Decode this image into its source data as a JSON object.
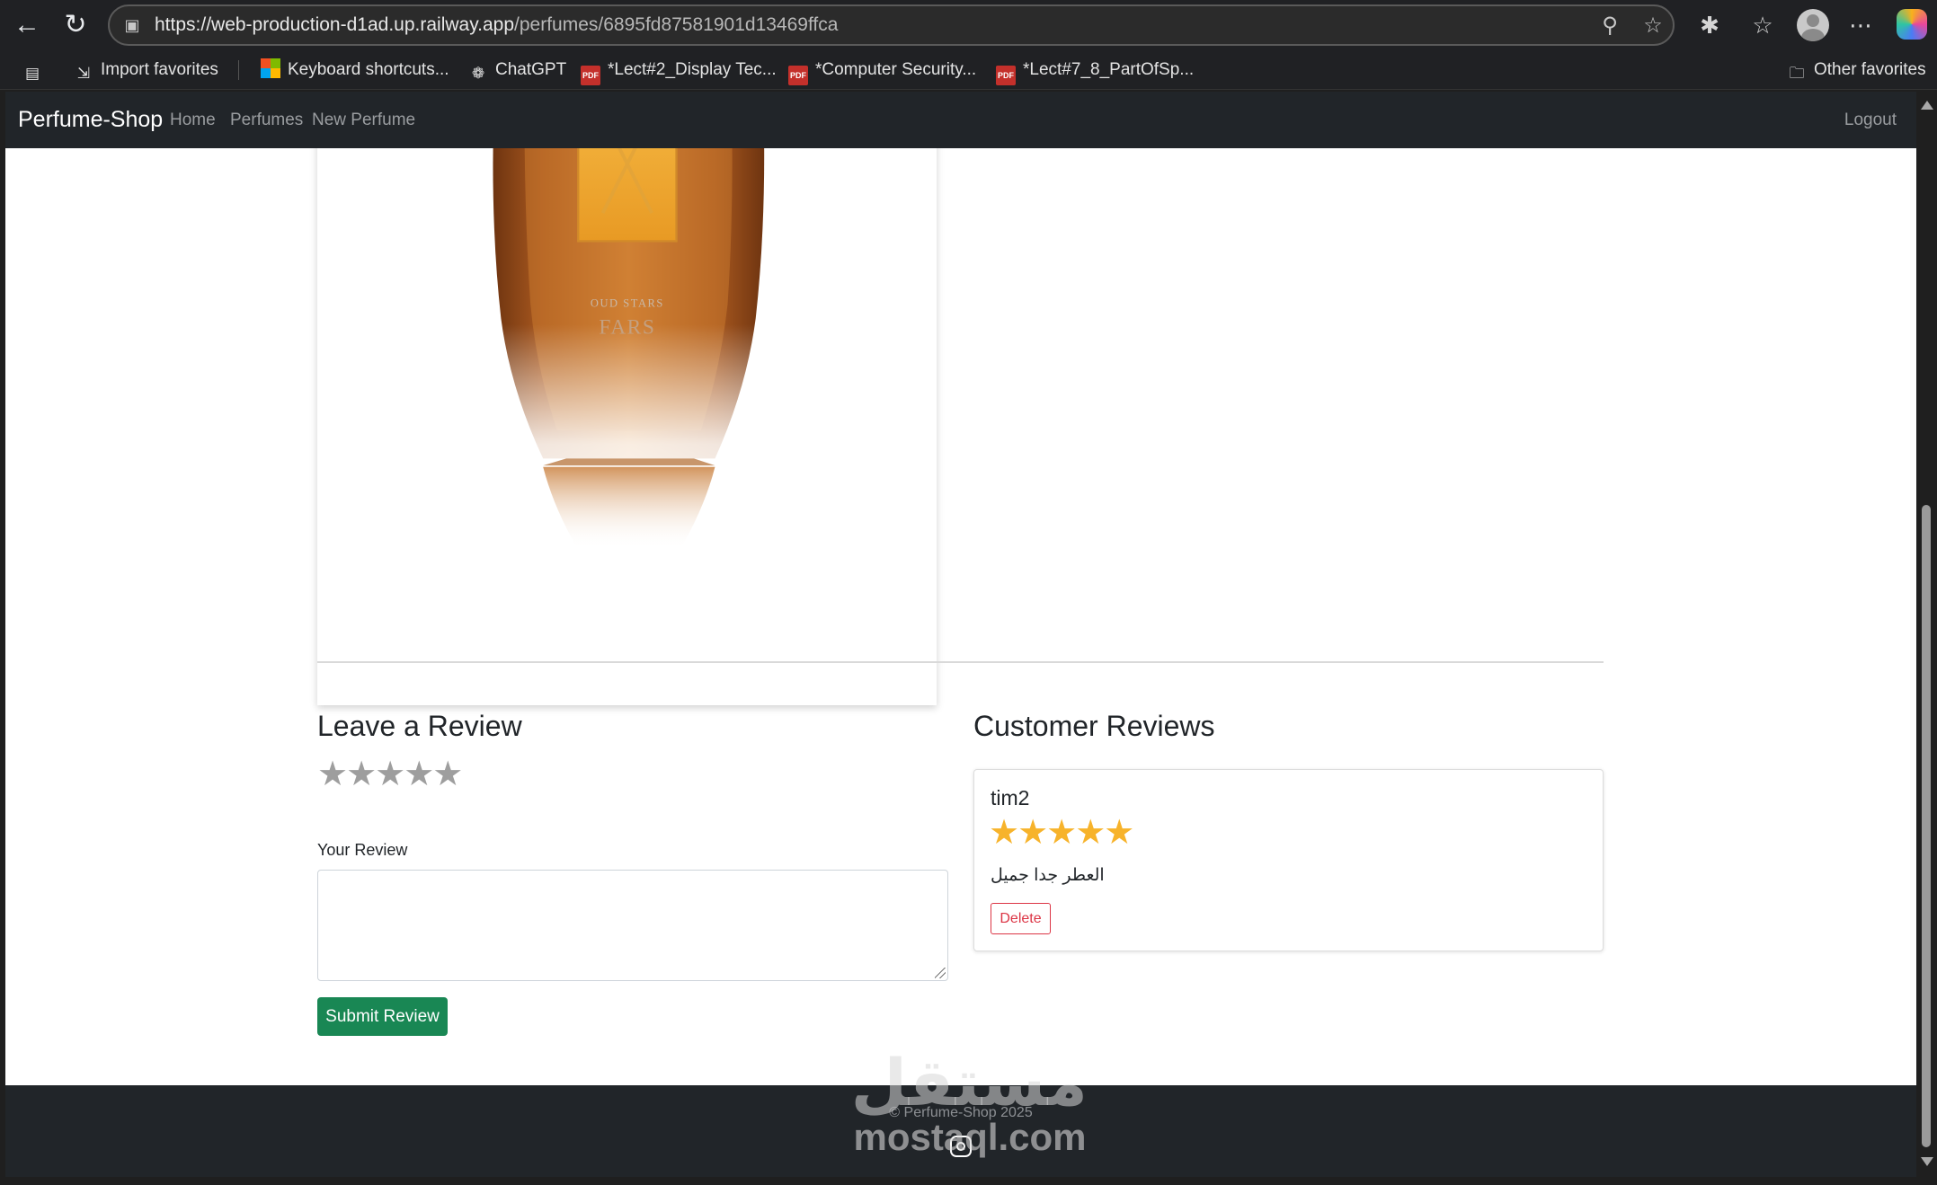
{
  "browser": {
    "url_host": "https://web-production-d1ad.up.railway.app",
    "url_path": "/perfumes/6895fd87581901d13469ffca",
    "bookmarks": [
      {
        "label": "Import favorites",
        "icon": "import-icon"
      },
      {
        "label": "Keyboard shortcuts...",
        "icon": "microsoft-icon"
      },
      {
        "label": "ChatGPT",
        "icon": "chatgpt-icon"
      },
      {
        "label": "*Lect#2_Display Tec...",
        "icon": "pdf-icon"
      },
      {
        "label": "*Computer Security...",
        "icon": "pdf-icon"
      },
      {
        "label": "*Lect#7_8_PartOfSp...",
        "icon": "pdf-icon"
      }
    ],
    "other_favorites": "Other favorites"
  },
  "navbar": {
    "brand": "Perfume-Shop",
    "links": [
      "Home",
      "Perfumes",
      "New Perfume"
    ],
    "logout": "Logout"
  },
  "product": {
    "image_label_top": "OUD STARS",
    "image_label_name": "FARS"
  },
  "review_form": {
    "title": "Leave a Review",
    "rating_stars": "★★★★★",
    "rating_value": 0,
    "rating_max": 5,
    "label": "Your Review",
    "value": "",
    "submit": "Submit Review"
  },
  "reviews": {
    "title": "Customer Reviews",
    "items": [
      {
        "user": "tim2",
        "stars": "★★★★★",
        "rating": 5,
        "text": "العطر جدا جميل",
        "delete": "Delete"
      }
    ]
  },
  "footer": {
    "text": "© Perfume-Shop 2025"
  },
  "watermark": {
    "arabic": "مستقل",
    "latin": "mostaql.com"
  },
  "colors": {
    "navbar": "#212529",
    "success": "#198754",
    "danger": "#dc3545",
    "star_filled": "#f7b32b",
    "star_empty": "#9e9e9e"
  }
}
